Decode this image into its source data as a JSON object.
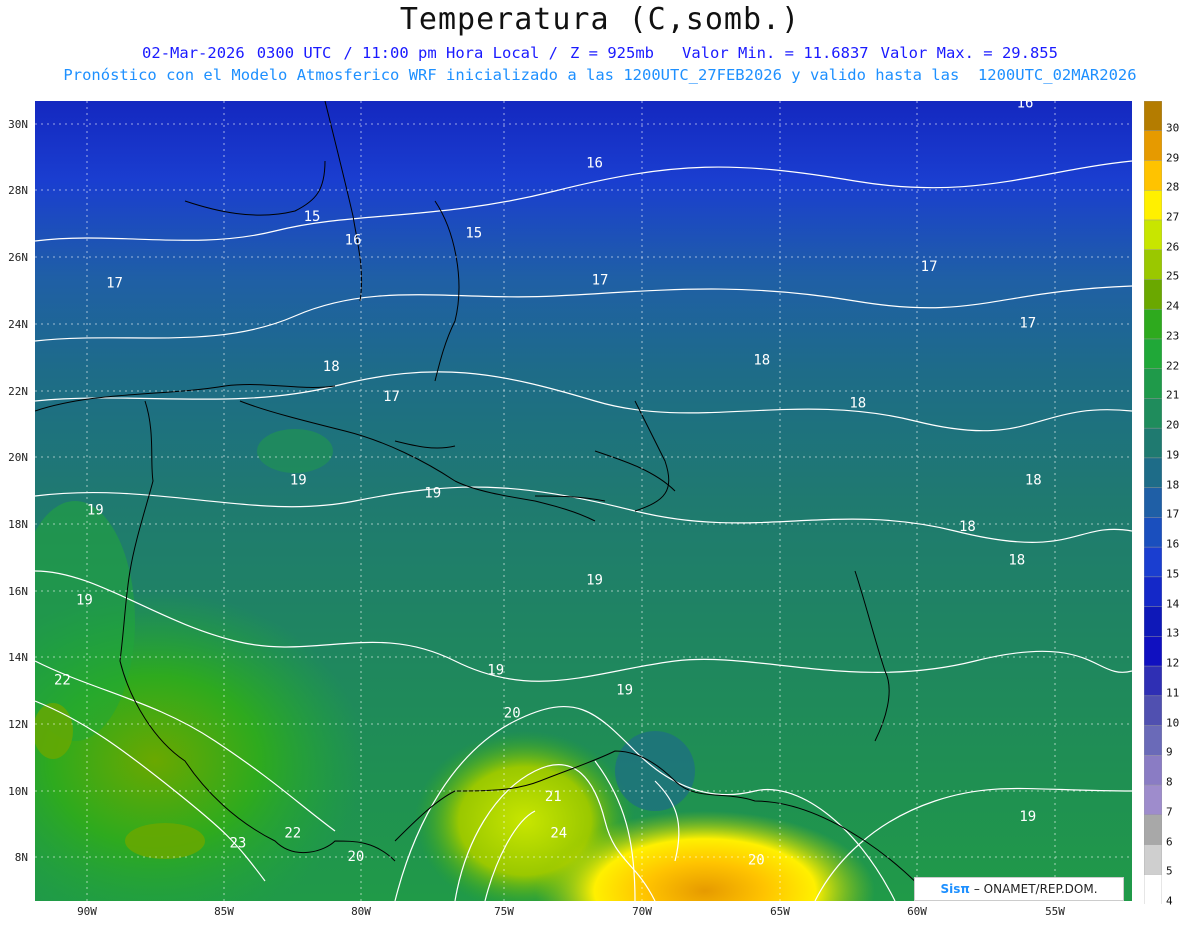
{
  "header": {
    "title": "Temperatura (C,somb.)",
    "date": "02-Mar-2026",
    "time_utc": "0300 UTC",
    "local_time": "/ 11:00 pm Hora Local /",
    "level": "Z = 925mb",
    "min_value": "Valor Min. = 11.6837",
    "max_value": "Valor Max. = 29.855",
    "model_info": "Pronóstico con el Modelo Atmosferico WRF inicializado a las 1200UTC_27FEB2026 y valido hasta las  1200UTC_02MAR2026"
  },
  "map": {
    "lon_range": [
      -92,
      -52
    ],
    "lat_range": [
      7,
      31
    ],
    "lat_ticks": [
      "30N",
      "28N",
      "26N",
      "24N",
      "22N",
      "20N",
      "18N",
      "16N",
      "14N",
      "12N",
      "10N",
      "8N"
    ],
    "lon_ticks": [
      "90W",
      "85W",
      "80W",
      "75W",
      "70W",
      "65W",
      "60W",
      "55W"
    ],
    "contour_labels": [
      {
        "text": "16",
        "lat": 30.8,
        "lon": -55.9
      },
      {
        "text": "16",
        "lat": 29.0,
        "lon": -71.6
      },
      {
        "text": "15",
        "lat": 27.4,
        "lon": -81.9
      },
      {
        "text": "16",
        "lat": 26.7,
        "lon": -80.4
      },
      {
        "text": "15",
        "lat": 26.9,
        "lon": -76.0
      },
      {
        "text": "17",
        "lat": 25.4,
        "lon": -89.1
      },
      {
        "text": "17",
        "lat": 25.5,
        "lon": -71.4
      },
      {
        "text": "17",
        "lat": 25.9,
        "lon": -59.4
      },
      {
        "text": "17",
        "lat": 24.2,
        "lon": -55.8
      },
      {
        "text": "18",
        "lat": 22.9,
        "lon": -81.2
      },
      {
        "text": "18",
        "lat": 23.1,
        "lon": -65.5
      },
      {
        "text": "17",
        "lat": 22.0,
        "lon": -79.0
      },
      {
        "text": "18",
        "lat": 21.8,
        "lon": -62.0
      },
      {
        "text": "19",
        "lat": 19.5,
        "lon": -82.4
      },
      {
        "text": "19",
        "lat": 19.1,
        "lon": -77.5
      },
      {
        "text": "18",
        "lat": 19.5,
        "lon": -55.6
      },
      {
        "text": "19",
        "lat": 18.6,
        "lon": -89.8
      },
      {
        "text": "18",
        "lat": 18.1,
        "lon": -58.0
      },
      {
        "text": "18",
        "lat": 17.1,
        "lon": -56.2
      },
      {
        "text": "19",
        "lat": 16.5,
        "lon": -71.6
      },
      {
        "text": "19",
        "lat": 15.9,
        "lon": -90.2
      },
      {
        "text": "19",
        "lat": 13.8,
        "lon": -75.2
      },
      {
        "text": "19",
        "lat": 13.2,
        "lon": -70.5
      },
      {
        "text": "22",
        "lat": 13.5,
        "lon": -91.0
      },
      {
        "text": "20",
        "lat": 12.5,
        "lon": -74.6
      },
      {
        "text": "21",
        "lat": 10.0,
        "lon": -73.1
      },
      {
        "text": "24",
        "lat": 8.9,
        "lon": -72.9
      },
      {
        "text": "23",
        "lat": 8.6,
        "lon": -84.6
      },
      {
        "text": "22",
        "lat": 8.9,
        "lon": -82.6
      },
      {
        "text": "20",
        "lat": 8.2,
        "lon": -80.3
      },
      {
        "text": "20",
        "lat": 8.1,
        "lon": -65.7
      },
      {
        "text": "19",
        "lat": 9.4,
        "lon": -55.8
      }
    ]
  },
  "colorbar": {
    "levels": [
      "30",
      "29",
      "28",
      "27",
      "26",
      "25",
      "24",
      "23",
      "22",
      "21",
      "20",
      "19",
      "18",
      "17",
      "16",
      "15",
      "14",
      "13",
      "12",
      "11",
      "10",
      "9",
      "8",
      "7",
      "6",
      "5",
      "4"
    ],
    "colors": {
      "30": "#b47c00",
      "29": "#e69a00",
      "28": "#ffc300",
      "27": "#fff000",
      "26": "#c8e600",
      "25": "#9ac800",
      "24": "#6aa800",
      "23": "#2eaa1e",
      "22": "#20a838",
      "21": "#1f9a4a",
      "20": "#1f8c5c",
      "19": "#1f7a70",
      "18": "#1e6c88",
      "17": "#1f5fa6",
      "16": "#1a4fbe",
      "15": "#1a3ed0",
      "14": "#1428c8",
      "13": "#0e18b8",
      "12": "#1010c0",
      "11": "#2f2fb4",
      "10": "#5050b0",
      "9": "#6a6ab8",
      "8": "#8a7cc4",
      "7": "#9e8ccc",
      "6": "#a8a8a8",
      "5": "#cfcfcf",
      "4": "#ffffff"
    }
  },
  "credit": {
    "logo": "Sisπ",
    "text": "– ONAMET/REP.DOM."
  }
}
